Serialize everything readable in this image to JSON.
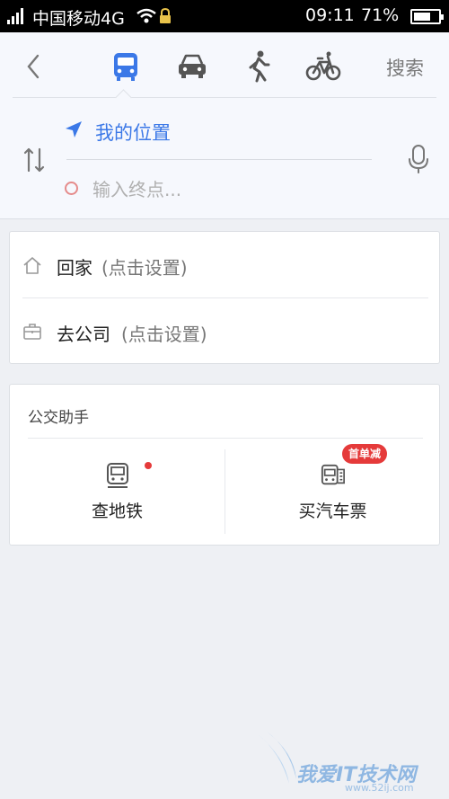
{
  "status_bar": {
    "carrier": "中国移动4G",
    "time": "09:11",
    "battery_text": "71%",
    "battery_level": 0.71
  },
  "header": {
    "transport_modes": [
      "bus",
      "car",
      "walk",
      "bike"
    ],
    "selected_mode": "bus",
    "search_label": "搜索",
    "start_label": "我的位置",
    "end_placeholder": "输入终点...",
    "accent_color": "#3b78e7"
  },
  "favorites": {
    "home": {
      "label": "回家",
      "hint": "(点击设置)"
    },
    "work": {
      "label": "去公司",
      "hint": "(点击设置)"
    }
  },
  "assistant": {
    "title": "公交助手",
    "items": [
      {
        "label": "查地铁"
      },
      {
        "label": "买汽车票",
        "badge": "首单减"
      }
    ]
  },
  "watermark": {
    "text": "我爱IT技术网",
    "url": "www.52ij.com"
  }
}
